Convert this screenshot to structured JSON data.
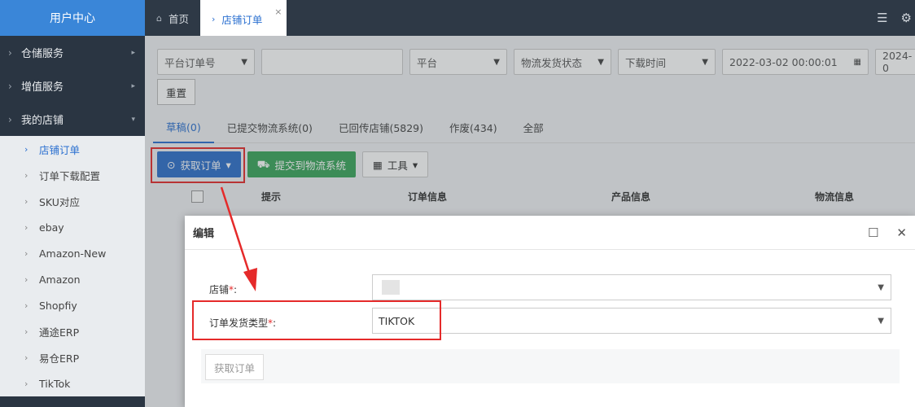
{
  "sidebar": {
    "title": "用户中心",
    "menus": [
      {
        "label": "仓储服务",
        "icon": "chevron-right-icon"
      },
      {
        "label": "增值服务",
        "icon": "chevron-right-icon"
      },
      {
        "label": "我的店铺",
        "icon": "chevron-right-icon"
      }
    ],
    "subitems": [
      "店铺订单",
      "订单下载配置",
      "SKU对应",
      "ebay",
      "Amazon-New",
      "Amazon",
      "Shopfiy",
      "通途ERP",
      "易仓ERP",
      "TikTok"
    ]
  },
  "topbar": {
    "tabs": [
      {
        "label": "首页",
        "icon": "home-icon"
      },
      {
        "label": "店铺订单",
        "icon": "chevron-right-icon"
      }
    ]
  },
  "filters": {
    "order_no": "平台订单号",
    "keyword": "",
    "platform": "平台",
    "logistics_status": "物流发货状态",
    "time_type": "下载时间",
    "start": "2022-03-02 00:00:01",
    "end": "2024-0",
    "reset": "重置"
  },
  "status_tabs": [
    "草稿(0)",
    "已提交物流系统(0)",
    "已回传店铺(5829)",
    "作废(434)",
    "全部"
  ],
  "toolbar": {
    "fetch": "获取订单",
    "submit": "提交到物流系统",
    "tools": "工具"
  },
  "table": {
    "headers": [
      "提示",
      "订单信息",
      "产品信息",
      "物流信息"
    ]
  },
  "dialog": {
    "title": "编辑",
    "store_label": "店铺",
    "type_label": "订单发货类型",
    "type_value": "TIKTOK",
    "fetch_button": "获取订单"
  },
  "colors": {
    "accent": "#2d6fcb",
    "highlight": "#e52a2a",
    "green": "#3aa55b"
  }
}
